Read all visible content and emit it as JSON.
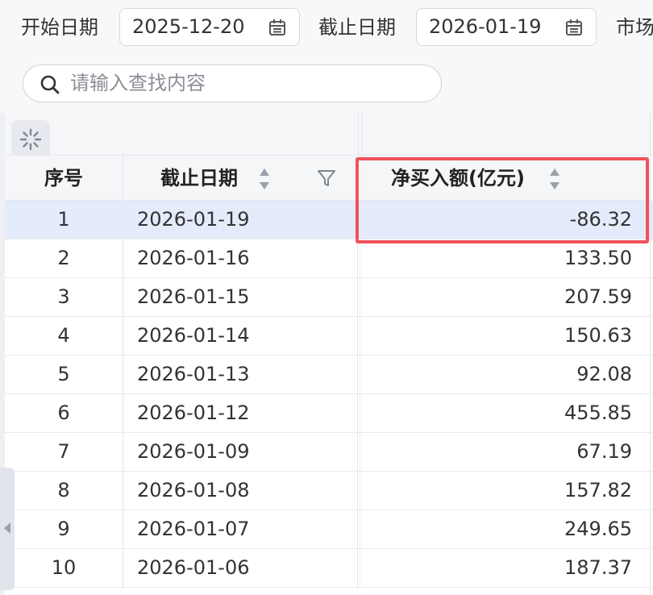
{
  "filters": {
    "start_label": "开始日期",
    "start_value": "2025-12-20",
    "end_label": "截止日期",
    "end_value": "2026-01-19",
    "market_label": "市场"
  },
  "search": {
    "placeholder": "请输入查找内容"
  },
  "table": {
    "headers": {
      "index": "序号",
      "date": "截止日期",
      "amount": "净买入额(亿元)"
    },
    "rows": [
      {
        "index": "1",
        "date": "2026-01-19",
        "amount": "-86.32",
        "selected": true
      },
      {
        "index": "2",
        "date": "2026-01-16",
        "amount": "133.50"
      },
      {
        "index": "3",
        "date": "2026-01-15",
        "amount": "207.59"
      },
      {
        "index": "4",
        "date": "2026-01-14",
        "amount": "150.63"
      },
      {
        "index": "5",
        "date": "2026-01-13",
        "amount": "92.08"
      },
      {
        "index": "6",
        "date": "2026-01-12",
        "amount": "455.85"
      },
      {
        "index": "7",
        "date": "2026-01-09",
        "amount": "67.19"
      },
      {
        "index": "8",
        "date": "2026-01-08",
        "amount": "157.82"
      },
      {
        "index": "9",
        "date": "2026-01-07",
        "amount": "249.65"
      },
      {
        "index": "10",
        "date": "2026-01-06",
        "amount": "187.37"
      }
    ]
  },
  "icons": {
    "calendar": "calendar-icon",
    "search": "search-icon",
    "loading": "loading-spinner-icon",
    "sort": "sort-icon",
    "filter": "filter-icon",
    "collapse": "chevron-left-icon"
  },
  "colors": {
    "highlight": "#f0525a",
    "selected_row": "#e4ebfa",
    "header_bg": "#f5f6f8"
  }
}
